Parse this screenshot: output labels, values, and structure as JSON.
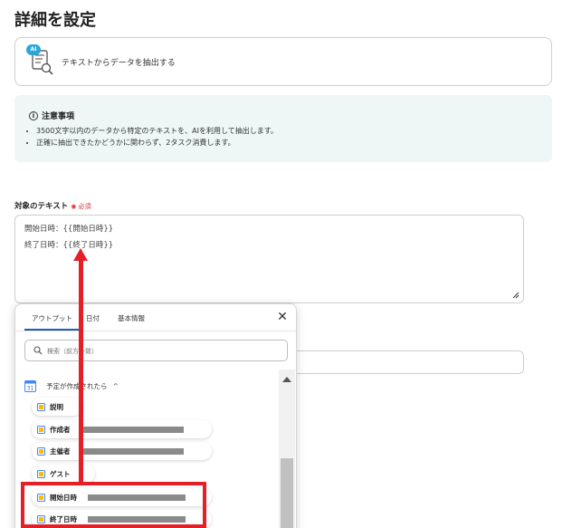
{
  "page": {
    "title": "詳細を設定"
  },
  "action": {
    "label": "テキストからデータを抽出する",
    "badge": "AI"
  },
  "notice": {
    "heading": "注意事項",
    "items": [
      "3500文字以内のデータから特定のテキストを、AIを利用して抽出します。",
      "正確に抽出できたかどうかに関わらず、2タスク消費します。"
    ]
  },
  "target_field": {
    "label": "対象のテキスト",
    "required": "◉ 必須",
    "lines": [
      "開始日時：{{開始日時}}",
      "終了日時：{{終了日時}}"
    ]
  },
  "popup": {
    "tabs": [
      "アウトプット",
      "日付",
      "基本情報"
    ],
    "search_placeholder": "検索（前方一致）",
    "group": {
      "label": "予定が作成されたら",
      "icon_text": "31"
    },
    "items": [
      {
        "label": "説明",
        "redacted": false
      },
      {
        "label": "作成者",
        "redacted": true
      },
      {
        "label": "主催者",
        "redacted": true
      },
      {
        "label": "ゲスト",
        "redacted": false
      },
      {
        "label": "開始日時",
        "redacted": true
      },
      {
        "label": "終了日時",
        "redacted": true
      }
    ]
  },
  "colors": {
    "accent": "#1f5fa8",
    "annotation": "#e51f27",
    "notice_bg": "#eef7f5"
  }
}
